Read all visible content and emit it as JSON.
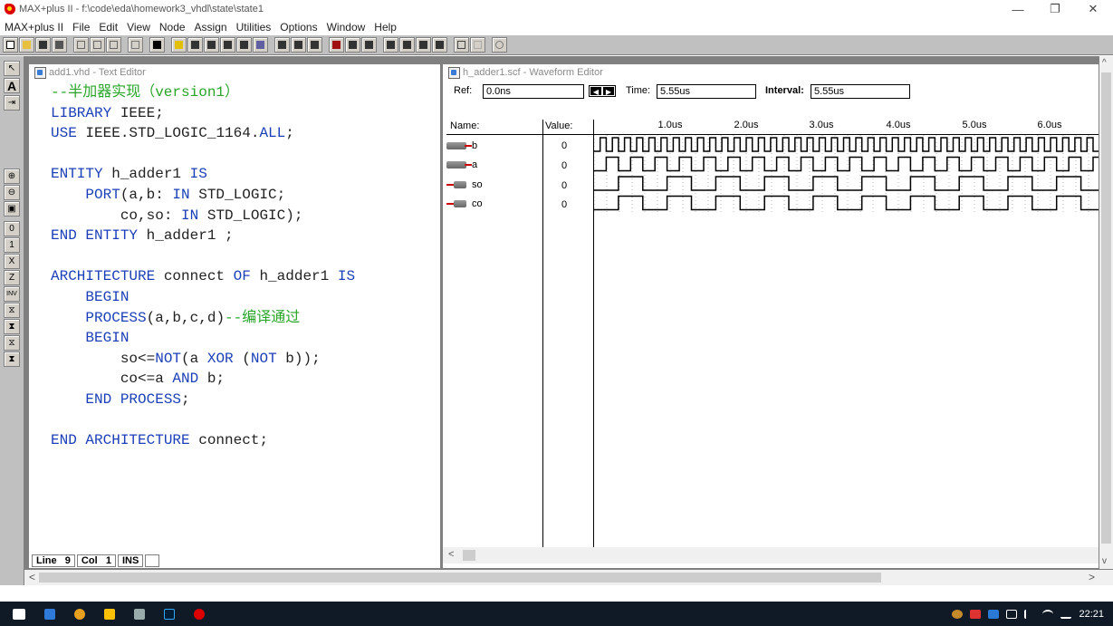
{
  "window": {
    "title": "MAX+plus II - f:\\code\\eda\\homework3_vhdl\\state\\state1",
    "controls": [
      "—",
      "❐",
      "✕"
    ]
  },
  "menu": [
    "MAX+plus II",
    "File",
    "Edit",
    "View",
    "Node",
    "Assign",
    "Utilities",
    "Options",
    "Window",
    "Help"
  ],
  "text_editor": {
    "title": "add1.vhd - Text Editor",
    "status": {
      "line_label": "Line",
      "line": "9",
      "col_label": "Col",
      "col": "1",
      "mode": "INS"
    }
  },
  "waveform_editor": {
    "title": "h_adder1.scf - Waveform Editor",
    "ref_label": "Ref:",
    "ref_value": "0.0ns",
    "time_label": "Time:",
    "time_value": "5.55us",
    "interval_label": "Interval:",
    "interval_value": "5.55us",
    "name_header": "Name:",
    "value_header": "Value:",
    "time_ticks": [
      "1.0us",
      "2.0us",
      "3.0us",
      "4.0us",
      "5.0us",
      "6.0us"
    ],
    "signals": [
      {
        "name": "b",
        "dir": "in",
        "value": "0",
        "period_us": 0.16
      },
      {
        "name": "a",
        "dir": "in",
        "value": "0",
        "period_us": 0.32
      },
      {
        "name": "so",
        "dir": "out",
        "value": "0",
        "period_us": 0.64
      },
      {
        "name": "co",
        "dir": "out",
        "value": "0",
        "period_us": 0.64
      }
    ]
  },
  "taskbar": {
    "clock": "22:21"
  },
  "colors": {
    "keyword": "#1c3fb8",
    "comment": "#2aa52a",
    "text": "#222222"
  }
}
